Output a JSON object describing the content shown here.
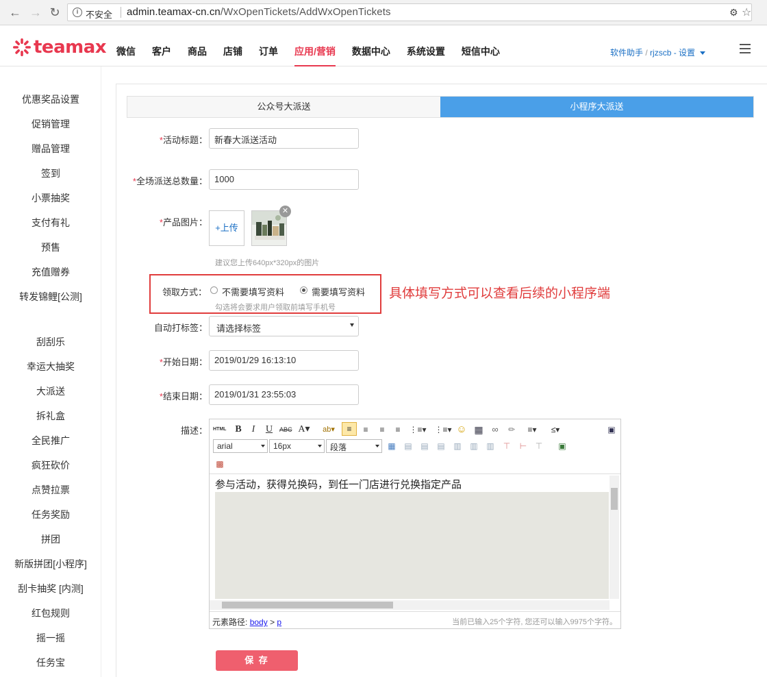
{
  "browser": {
    "insecure_label": "不安全",
    "url_host": "admin.teamax-cn.cn",
    "url_path": "/WxOpenTickets/AddWxOpenTickets"
  },
  "header": {
    "logo_text": "teamax",
    "nav": [
      {
        "label": "微信",
        "active": false
      },
      {
        "label": "客户",
        "active": false
      },
      {
        "label": "商品",
        "active": false
      },
      {
        "label": "店铺",
        "active": false
      },
      {
        "label": "订单",
        "active": false
      },
      {
        "label": "应用/营销",
        "active": true
      },
      {
        "label": "数据中心",
        "active": false
      },
      {
        "label": "系统设置",
        "active": false
      },
      {
        "label": "短信中心",
        "active": false
      }
    ],
    "user": {
      "helper": "软件助手",
      "slash": " / ",
      "username": "rjzscb",
      "dash": " - ",
      "settings": "设置"
    }
  },
  "sidebar": {
    "items": [
      "优惠奖品设置",
      "促销管理",
      "赠品管理",
      "签到",
      "小票抽奖",
      "支付有礼",
      "预售",
      "充值赠券",
      "转发锦鲤[公测]",
      "刮刮乐",
      "幸运大抽奖",
      "大派送",
      "拆礼盒",
      "全民推广",
      "疯狂砍价",
      "点赞拉票",
      "任务奖励",
      "拼团",
      "新版拼团[小程序]",
      "刮卡抽奖 [内测]",
      "红包规则",
      "摇一摇",
      "任务宝"
    ]
  },
  "tabs": [
    {
      "label": "公众号大派送",
      "active": false
    },
    {
      "label": "小程序大派送",
      "active": true
    }
  ],
  "form": {
    "title_label": "活动标题：",
    "title_value": "新春大派送活动",
    "total_label": "全场派送总数量：",
    "total_value": "1000",
    "image_label": "产品图片：",
    "upload_label": "+上传",
    "image_hint": "建议您上传640px*320px的图片",
    "claim_label": "领取方式：",
    "claim_options": [
      "不需要填写资料",
      "需要填写资料"
    ],
    "claim_selected": 1,
    "claim_hint": "勾选将会要求用户领取前填写手机号",
    "tag_label": "自动打标签：",
    "tag_value": "请选择标签",
    "start_label": "开始日期：",
    "start_value": "2019/01/29 16:13:10",
    "end_label": "结束日期：",
    "end_value": "2019/01/31 23:55:03",
    "desc_label": "描述：",
    "save_label": "保 存"
  },
  "annotation": "具体填写方式可以查看后续的小程序端",
  "editor": {
    "html_btn": "HTML",
    "font_family": "arial",
    "font_size": "16px",
    "paragraph": "段落",
    "content": "参与活动，获得兑换码，到任一门店进行兑换指定产品",
    "path_label": "元素路径:",
    "path_body": "body",
    "path_sep": ">",
    "path_p": "p",
    "count_text": "当前已输入25个字符, 您还可以输入9975个字符。"
  },
  "colors": {
    "brand": "#e8384f",
    "tab_active": "#4a9fe8",
    "link": "#1a6fc4",
    "annotation": "#e03c3c"
  }
}
